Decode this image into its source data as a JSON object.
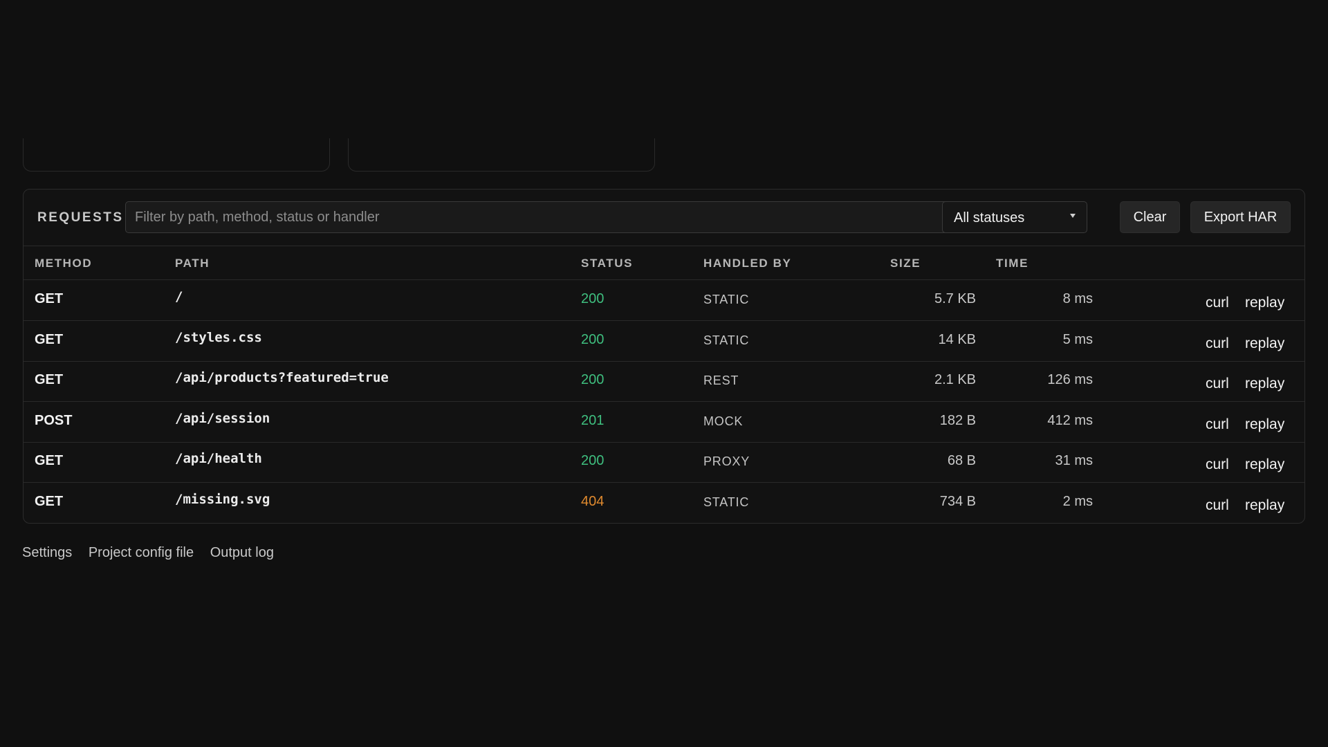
{
  "requests_panel": {
    "title": "REQUESTS",
    "filter_placeholder": "Filter by path, method, status or handler",
    "filter_value": "",
    "status_filter": "All statuses",
    "clear_label": "Clear",
    "export_label": "Export HAR",
    "columns": {
      "method": "METHOD",
      "path": "PATH",
      "status": "STATUS",
      "handled_by": "HANDLED BY",
      "size": "SIZE",
      "time": "TIME"
    },
    "rows": [
      {
        "method": "GET",
        "path": "/",
        "status": "200",
        "handled_by": "STATIC",
        "size": "5.7 KB",
        "time": "8 ms",
        "curl": "curl",
        "replay": "replay"
      },
      {
        "method": "GET",
        "path": "/styles.css",
        "status": "200",
        "handled_by": "STATIC",
        "size": "14 KB",
        "time": "5 ms",
        "curl": "curl",
        "replay": "replay"
      },
      {
        "method": "GET",
        "path": "/api/products?featured=true",
        "status": "200",
        "handled_by": "REST",
        "size": "2.1 KB",
        "time": "126 ms",
        "curl": "curl",
        "replay": "replay"
      },
      {
        "method": "POST",
        "path": "/api/session",
        "status": "201",
        "handled_by": "MOCK",
        "size": "182 B",
        "time": "412 ms",
        "curl": "curl",
        "replay": "replay"
      },
      {
        "method": "GET",
        "path": "/api/health",
        "status": "200",
        "handled_by": "PROXY",
        "size": "68 B",
        "time": "31 ms",
        "curl": "curl",
        "replay": "replay"
      },
      {
        "method": "GET",
        "path": "/missing.svg",
        "status": "404",
        "handled_by": "STATIC",
        "size": "734 B",
        "time": "2 ms",
        "curl": "curl",
        "replay": "replay"
      }
    ]
  },
  "footer": {
    "settings": "Settings",
    "project_config": "Project config file",
    "output_log": "Output log"
  },
  "colors": {
    "status_ok": "#3fbf7f",
    "status_error": "#e08a2e"
  }
}
